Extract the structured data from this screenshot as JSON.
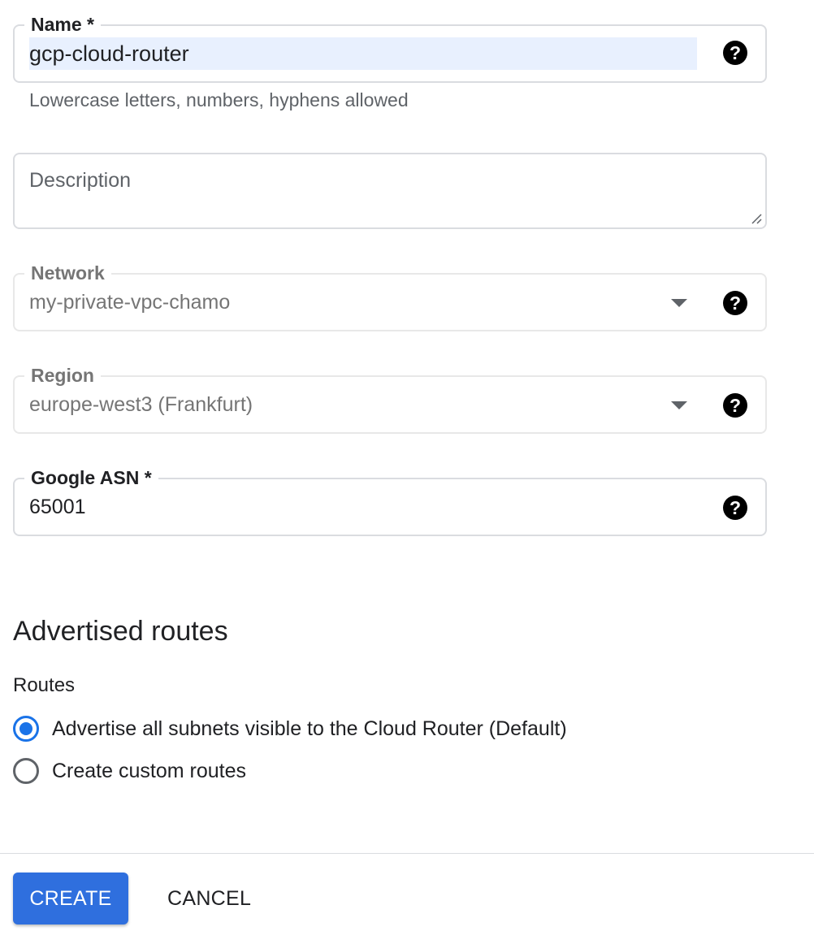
{
  "form": {
    "name": {
      "label": "Name *",
      "value": "gcp-cloud-router",
      "hint": "Lowercase letters, numbers, hyphens allowed",
      "help_icon": "help-circle-icon"
    },
    "description": {
      "placeholder": "Description",
      "value": ""
    },
    "network": {
      "label": "Network",
      "value": "my-private-vpc-chamo",
      "help_icon": "help-circle-icon"
    },
    "region": {
      "label": "Region",
      "value": "europe-west3 (Frankfurt)",
      "help_icon": "help-circle-icon"
    },
    "asn": {
      "label": "Google ASN *",
      "value": "65001",
      "help_icon": "help-circle-icon"
    }
  },
  "advertised_routes": {
    "heading": "Advertised routes",
    "routes_label": "Routes",
    "options": [
      {
        "label": "Advertise all subnets visible to the Cloud Router (Default)",
        "selected": true
      },
      {
        "label": "Create custom routes",
        "selected": false
      }
    ]
  },
  "actions": {
    "create_label": "CREATE",
    "cancel_label": "CANCEL"
  },
  "colors": {
    "accent": "#1a73e8",
    "primary_button": "#2f6fde",
    "selection_highlight": "#e8f0fe",
    "border": "#dadce0",
    "disabled_text": "#757575"
  }
}
